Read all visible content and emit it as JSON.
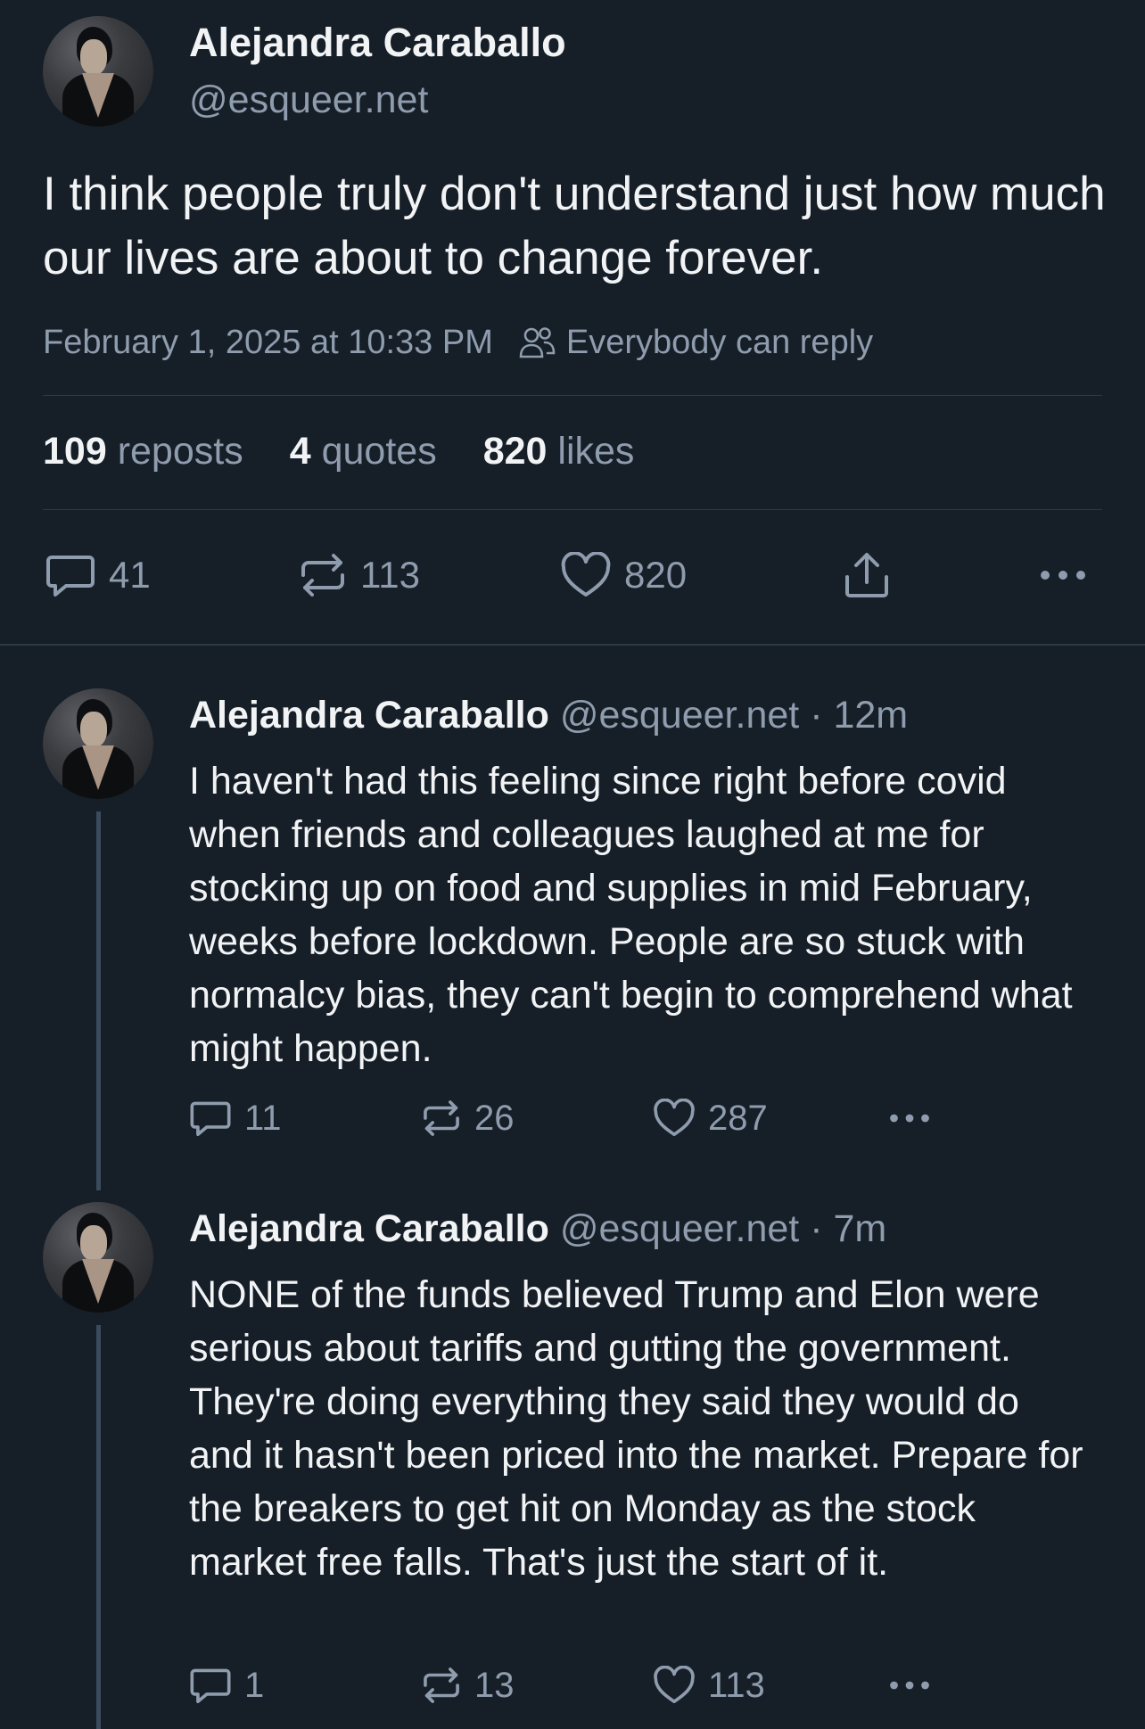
{
  "main_post": {
    "author_name": "Alejandra Caraballo",
    "author_handle": "@esqueer.net",
    "text": "I think people truly don't understand just how much our lives are about to change forever.",
    "timestamp": "February 1, 2025 at 10:33 PM",
    "reply_setting": "Everybody can reply",
    "stats": {
      "reposts_count": "109",
      "reposts_label": "reposts",
      "quotes_count": "4",
      "quotes_label": "quotes",
      "likes_count": "820",
      "likes_label": "likes"
    },
    "actions": {
      "replies": "41",
      "reposts": "113",
      "likes": "820"
    }
  },
  "replies": [
    {
      "author_name": "Alejandra Caraballo",
      "author_handle": "@esqueer.net",
      "separator": "·",
      "time": "12m",
      "text": "I haven't had this feeling since right before covid when friends and colleagues laughed at me for stocking up on food and supplies in mid February, weeks before lockdown. People are so stuck with normalcy bias, they can't begin to comprehend what might happen.",
      "replies": "11",
      "reposts": "26",
      "likes": "287"
    },
    {
      "author_name": "Alejandra Caraballo",
      "author_handle": "@esqueer.net",
      "separator": "·",
      "time": "7m",
      "text": "NONE of the funds believed Trump and Elon were serious about tariffs and gutting the government. They're doing everything they said they would do and it hasn't been priced into the market. Prepare for the breakers to get hit on Monday as the stock market free falls. That's just the start of it.",
      "replies": "1",
      "reposts": "13",
      "likes": "113"
    }
  ],
  "icons": {
    "reply": "speech-bubble-icon",
    "repost": "repost-arrows-icon",
    "like": "heart-icon",
    "share": "share-upload-icon",
    "more": "more-dots-icon",
    "reply_setting": "people-icon"
  },
  "colors": {
    "background": "#161e27",
    "text_primary": "#f1f3f5",
    "text_secondary": "#8e9cae",
    "divider": "#2c3947",
    "thread_line": "#3b4a5c"
  }
}
